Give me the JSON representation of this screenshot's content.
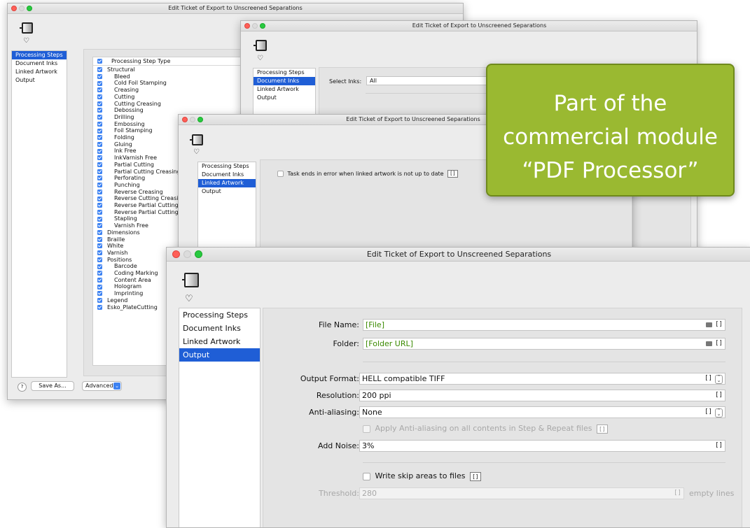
{
  "window_title": "Edit Ticket of Export to Unscreened Separations",
  "nav_items": [
    "Processing Steps",
    "Document Inks",
    "Linked Artwork",
    "Output"
  ],
  "icons": {
    "ticket": "ticket-icon",
    "bell": "bell-icon",
    "help": "help-icon",
    "dropdown": "chevron-down-icon",
    "folder": "folder-icon",
    "stepper": "stepper-icon"
  },
  "colors": {
    "selection": "#1f5ed6",
    "checkbox": "#3d82f2",
    "green_note": "#9ab931",
    "param_value": "#3a8a00"
  },
  "processing_steps": {
    "header": "Processing Step Type",
    "rows": [
      {
        "label": "Structural",
        "indent": 0
      },
      {
        "label": "Bleed",
        "indent": 1
      },
      {
        "label": "Cold Foil Stamping",
        "indent": 1
      },
      {
        "label": "Creasing",
        "indent": 1
      },
      {
        "label": "Cutting",
        "indent": 1
      },
      {
        "label": "Cutting Creasing",
        "indent": 1
      },
      {
        "label": "Debossing",
        "indent": 1
      },
      {
        "label": "Drilling",
        "indent": 1
      },
      {
        "label": "Embossing",
        "indent": 1
      },
      {
        "label": "Foil Stamping",
        "indent": 1
      },
      {
        "label": "Folding",
        "indent": 1
      },
      {
        "label": "Gluing",
        "indent": 1
      },
      {
        "label": "Ink Free",
        "indent": 1
      },
      {
        "label": "InkVarnish Free",
        "indent": 1
      },
      {
        "label": "Partial Cutting",
        "indent": 1
      },
      {
        "label": "Partial Cutting Creasing",
        "indent": 1
      },
      {
        "label": "Perforating",
        "indent": 1
      },
      {
        "label": "Punching",
        "indent": 1
      },
      {
        "label": "Reverse Creasing",
        "indent": 1
      },
      {
        "label": "Reverse Cutting Creasing",
        "indent": 1
      },
      {
        "label": "Reverse Partial Cutting",
        "indent": 1
      },
      {
        "label": "Reverse Partial Cutting Cre",
        "indent": 1
      },
      {
        "label": "Stapling",
        "indent": 1
      },
      {
        "label": "Varnish Free",
        "indent": 1
      },
      {
        "label": "Dimensions",
        "indent": 0
      },
      {
        "label": "Braille",
        "indent": 0
      },
      {
        "label": "White",
        "indent": 0
      },
      {
        "label": "Varnish",
        "indent": 0
      },
      {
        "label": "Positions",
        "indent": 0
      },
      {
        "label": "Barcode",
        "indent": 1
      },
      {
        "label": "Coding Marking",
        "indent": 1
      },
      {
        "label": "Content Area",
        "indent": 1
      },
      {
        "label": "Hologram",
        "indent": 1
      },
      {
        "label": "Imprinting",
        "indent": 1
      },
      {
        "label": "Legend",
        "indent": 0
      },
      {
        "label": "Esko_PlateCutting",
        "indent": 0
      }
    ]
  },
  "footer": {
    "help": "?",
    "save_as": "Save As...",
    "advanced": "Advanced"
  },
  "document_inks": {
    "select_label": "Select Inks:",
    "select_value": "All"
  },
  "linked_artwork": {
    "checkbox_label": "Task ends in error when linked artwork is not up to date",
    "param_button": "[]"
  },
  "output": {
    "file_name": {
      "label": "File Name:",
      "value": "[File]"
    },
    "folder": {
      "label": "Folder:",
      "value": "[Folder URL]"
    },
    "output_format": {
      "label": "Output Format:",
      "value": "HELL compatible TIFF"
    },
    "resolution": {
      "label": "Resolution:",
      "value": "200 ppi"
    },
    "anti_aliasing": {
      "label": "Anti-aliasing:",
      "value": "None"
    },
    "apply_aa_label": "Apply Anti-aliasing on all contents in Step & Repeat files",
    "add_noise": {
      "label": "Add Noise:",
      "value": "3%"
    },
    "skip_areas_label": "Write skip areas to files",
    "threshold": {
      "label": "Threshold:",
      "value": "280",
      "unit": "empty lines"
    },
    "param_button": "[]"
  },
  "callout": {
    "line1": "Part of the",
    "line2": "commercial module",
    "line3": "“PDF Processor”"
  }
}
